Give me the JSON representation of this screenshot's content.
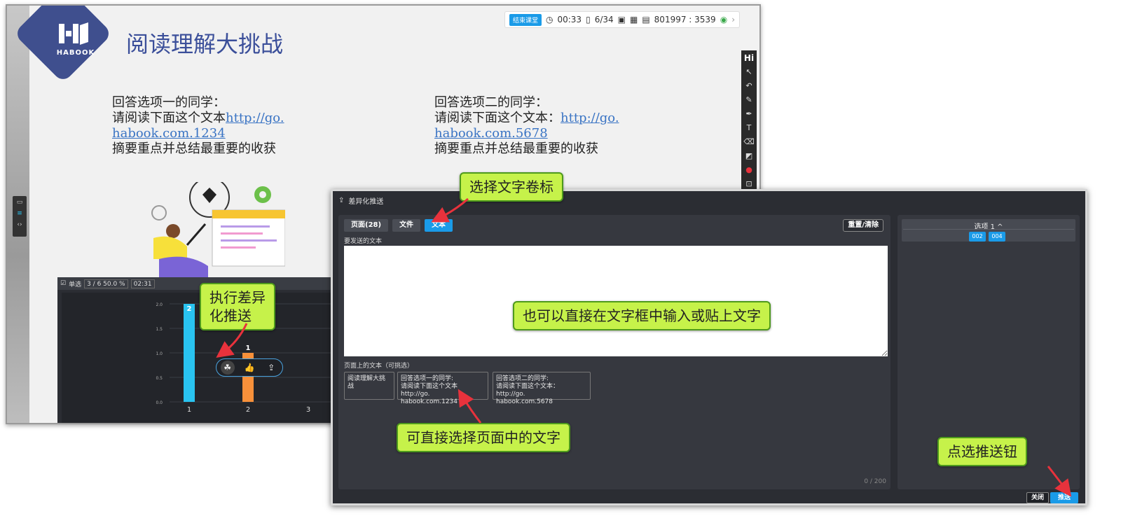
{
  "slide": {
    "logo_text": "HABOOK",
    "title": "阅读理解大挑战",
    "option1": {
      "line1": "回答选项一的同学：",
      "line2_prefix": "请阅读下面这个文本",
      "link_a": "http://go.",
      "link_b": "habook.com.1234",
      "line4": "摘要重点并总结最重要的收获"
    },
    "option2": {
      "line1": "回答选项二的同学：",
      "line2_prefix": "请阅读下面这个文本：",
      "link_a": "http://go.",
      "link_b": "habook.com.5678",
      "line4": "摘要重点并总结最重要的收获"
    }
  },
  "top_toolbar": {
    "badge": "结束课堂",
    "timer": "00:33",
    "pages": "6/34",
    "code": "801997 : 3539"
  },
  "right_toolbar": {
    "hi_label": "Hi"
  },
  "chart_panel": {
    "mode_label": "单选",
    "stats": "3 / 6  50.0 %",
    "time": "02:31"
  },
  "chart_data": {
    "type": "bar",
    "categories": [
      "1",
      "2",
      "3"
    ],
    "values": [
      2,
      1,
      0
    ],
    "data_labels": [
      "2",
      "1",
      ""
    ],
    "bar_colors": [
      "#29c3f0",
      "#f7903a",
      "#888888"
    ],
    "y_ticks": [
      "0.0",
      "0.5",
      "1.0",
      "1.5",
      "2.0"
    ],
    "ylim": [
      0,
      2
    ],
    "grid": true
  },
  "dialog": {
    "title": "差异化推送",
    "tabs": [
      "页面(28)",
      "文件",
      "文本"
    ],
    "active_tab": "文本",
    "reset_label": "重置/清除",
    "to_send_label": "要发送的文本",
    "page_text_label": "页面上的文本（可挑选）",
    "choices": [
      "阅读理解大挑战",
      "回答选项一的同学:\n请阅读下面这个文本http://go.\nhabook.com.1234",
      "回答选项二的同学:\n请阅读下面这个文本：http://go.\nhabook.com.5678"
    ],
    "counter": "0 / 200",
    "option_group_title": "选项 1 ^",
    "option_chips": [
      "002",
      "004"
    ],
    "close_label": "关闭",
    "push_label": "推送"
  },
  "callouts": {
    "select_text_tab": "选择文字卷标",
    "run_push": "执行差异\n化推送",
    "type_or_paste": "也可以直接在文字框中输入或贴上文字",
    "select_page_text": "可直接选择页面中的文字",
    "click_push": "点选推送钮"
  },
  "colors": {
    "accent": "#1a9be8",
    "callout_bg": "#c6f24a",
    "arrow": "#e8323c",
    "dialog_bg": "#2b2d33"
  }
}
